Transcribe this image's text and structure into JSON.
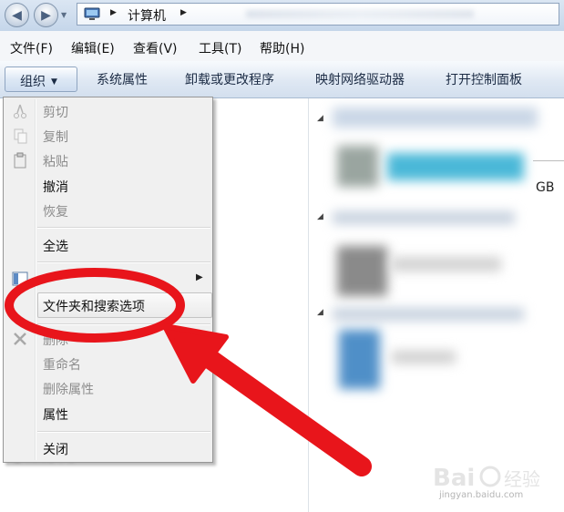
{
  "addressbar": {
    "breadcrumb_current": "计算机",
    "arrow": "▶"
  },
  "menubar": {
    "items": [
      "文件(F)",
      "编辑(E)",
      "查看(V)",
      "工具(T)",
      "帮助(H)"
    ]
  },
  "toolbar": {
    "organize_label": "组织",
    "organize_caret": "▼",
    "buttons": [
      "系统属性",
      "卸载或更改程序",
      "映射网络驱动器",
      "打开控制面板"
    ]
  },
  "context_menu": {
    "items": {
      "cut": "剪切",
      "copy": "复制",
      "paste": "粘贴",
      "undo": "撤消",
      "redo": "恢复",
      "select_all": "全选",
      "folder_options": "文件夹和搜索选项",
      "delete": "删除",
      "rename": "重命名",
      "remove_properties": "删除属性",
      "properties": "属性",
      "close": "关闭"
    },
    "submenu_arrow": "▶",
    "disabled_items": [
      "cut",
      "copy",
      "paste",
      "redo",
      "delete",
      "rename",
      "remove_properties"
    ]
  },
  "content": {
    "partial_size_text": "GB",
    "group_marker": "◢"
  },
  "watermark": {
    "url": "jingyan.baidu.com"
  },
  "colors": {
    "annotation_red": "#e8151b",
    "toolbar_text": "#1b2b44",
    "disabled_text": "#8d8d8d"
  },
  "icons": {
    "back": "back-arrow-icon",
    "forward": "forward-arrow-icon",
    "computer": "computer-icon",
    "cut": "scissors-icon",
    "copy": "copy-icon",
    "paste": "paste-icon",
    "layout": "layout-icon",
    "delete": "delete-x-icon"
  }
}
